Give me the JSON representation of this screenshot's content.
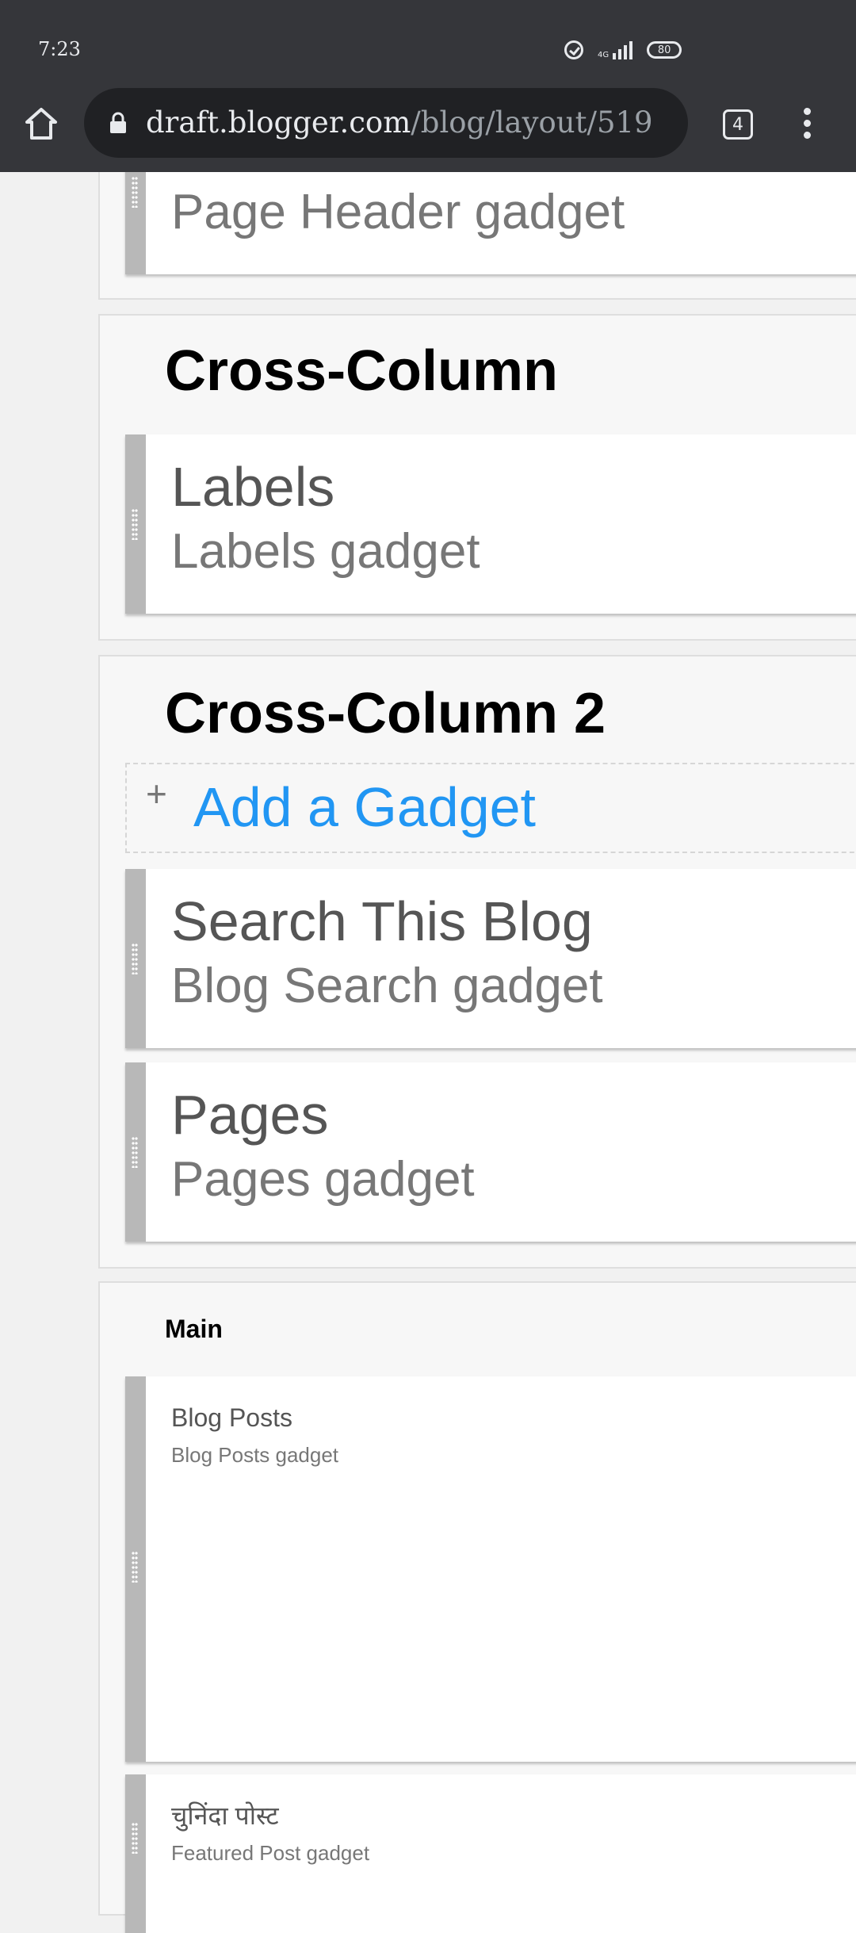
{
  "status_bar": {
    "time": "7:23",
    "network_label": "4G",
    "battery_level": "80"
  },
  "browser": {
    "url_host": "draft.blogger.com",
    "url_path": "/blog/layout/519",
    "tab_count": "4",
    "icons": [
      "home-icon",
      "lock-icon",
      "tab-switcher-icon",
      "more-vert-icon"
    ]
  },
  "layout": {
    "top_widget": {
      "subtitle": "Page Header gadget"
    },
    "cross_column": {
      "title": "Cross-Column",
      "widgets": [
        {
          "title": "Labels",
          "subtitle": "Labels gadget"
        }
      ]
    },
    "cross_column_2": {
      "title": "Cross-Column 2",
      "add_gadget": {
        "plus": "+",
        "label": "Add a Gadget"
      },
      "widgets": [
        {
          "title": "Search This Blog",
          "subtitle": "Blog Search gadget"
        },
        {
          "title": "Pages",
          "subtitle": "Pages gadget"
        }
      ]
    },
    "main": {
      "title": "Main",
      "widgets": [
        {
          "title": "Blog Posts",
          "subtitle": "Blog Posts gadget"
        },
        {
          "title": "चुनिंदा पोस्ट",
          "subtitle": "Featured Post gadget"
        }
      ]
    }
  },
  "colors": {
    "chrome_bg": "#35363a",
    "urlbar_bg": "#202124",
    "link_blue": "#2196f3",
    "page_bg": "#f1f1f1",
    "drag_handle": "#b8b8b8"
  }
}
